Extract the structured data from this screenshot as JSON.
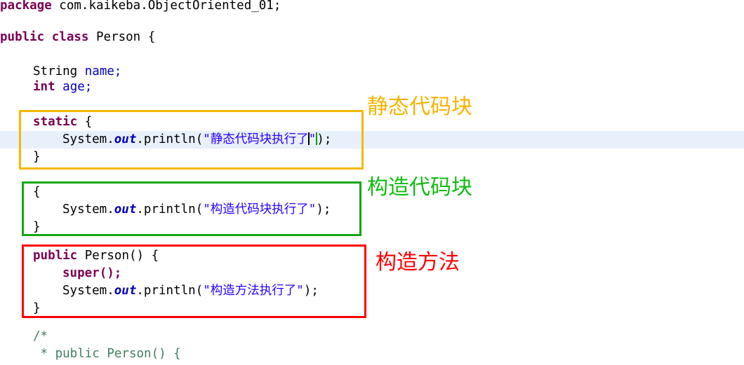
{
  "editor": {
    "background_color": "#ffffff",
    "caret_line_color": "#e8f0fc",
    "syntax_colors": {
      "keyword": "#7a0055",
      "plain": "#000000",
      "field": "#0000c0",
      "static_field": "#0000c0",
      "string": "#2a00ff",
      "comment": "#3f7f5f"
    }
  },
  "code": {
    "line_package": {
      "keyword": "package",
      "rest": " com.kaikeba.ObjectOriented_01;"
    },
    "line_class": {
      "kw_public": "public",
      "kw_class": "class",
      "name": "Person",
      "brace": "{"
    },
    "line_field_name": {
      "type": "String",
      "name": "name",
      "semi": ";"
    },
    "line_field_age": {
      "type": "int",
      "name": "age",
      "semi": ";"
    },
    "static_block": {
      "keyword": "static",
      "open_brace": "{",
      "call_obj": "System",
      "dot1": ".",
      "call_field": "out",
      "dot2": ".",
      "call_method": "println",
      "paren_open": "(",
      "string": "\"静态代码块执行了\"",
      "string_open_quote": "\"",
      "string_text": "静态代码块执行了",
      "string_close_quote": "\"",
      "paren_close": ")",
      "semi": ";",
      "close_brace": "}"
    },
    "instance_block": {
      "open_brace": "{",
      "call_obj": "System",
      "dot1": ".",
      "call_field": "out",
      "dot2": ".",
      "call_method": "println",
      "paren_open": "(",
      "string_open_quote": "\"",
      "string_text": "构造代码块执行了",
      "string_close_quote": "\"",
      "paren_close": ")",
      "semi": ";",
      "close_brace": "}"
    },
    "constructor": {
      "kw_public": "public",
      "name": "Person",
      "parens": "()",
      "open_brace": "{",
      "kw_super": "super",
      "super_parens": "();",
      "call_obj": "System",
      "dot1": ".",
      "call_field": "out",
      "dot2": ".",
      "call_method": "println",
      "paren_open": "(",
      "string_open_quote": "\"",
      "string_text": "构造方法执行了",
      "string_close_quote": "\"",
      "paren_close": ")",
      "semi": ";",
      "close_brace": "}"
    },
    "comment_block": {
      "line1": "/*",
      "line2": " * public Person() {"
    }
  },
  "annotations": [
    {
      "id": "static-block",
      "label": "静态代码块",
      "color": "#f5b400"
    },
    {
      "id": "instance-block",
      "label": "构造代码块",
      "color": "#11bb11"
    },
    {
      "id": "constructor-method",
      "label": "构造方法",
      "color": "#ff0000"
    }
  ]
}
